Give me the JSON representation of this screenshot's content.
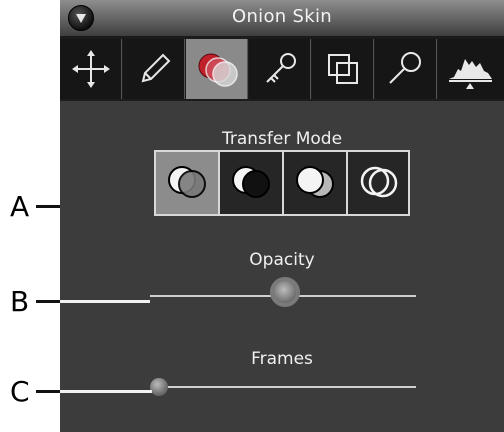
{
  "panel": {
    "title": "Onion Skin",
    "toolbar": [
      {
        "icon": "move-icon"
      },
      {
        "icon": "pencil-icon"
      },
      {
        "icon": "onion-skin-icon",
        "active": true
      },
      {
        "icon": "key-icon"
      },
      {
        "icon": "layers-icon"
      },
      {
        "icon": "magnifier-icon"
      },
      {
        "icon": "histogram-icon"
      }
    ],
    "transfer_mode": {
      "label": "Transfer Mode",
      "modes": [
        {
          "icon": "blend-normal-icon",
          "active": true
        },
        {
          "icon": "blend-dark-icon"
        },
        {
          "icon": "blend-light-icon"
        },
        {
          "icon": "blend-outline-icon"
        }
      ]
    },
    "opacity": {
      "label": "Opacity",
      "value_fraction": 0.5
    },
    "frames": {
      "label": "Frames",
      "value_fraction": 0.0
    }
  },
  "callouts": {
    "a": "A",
    "b": "B",
    "c": "C"
  }
}
